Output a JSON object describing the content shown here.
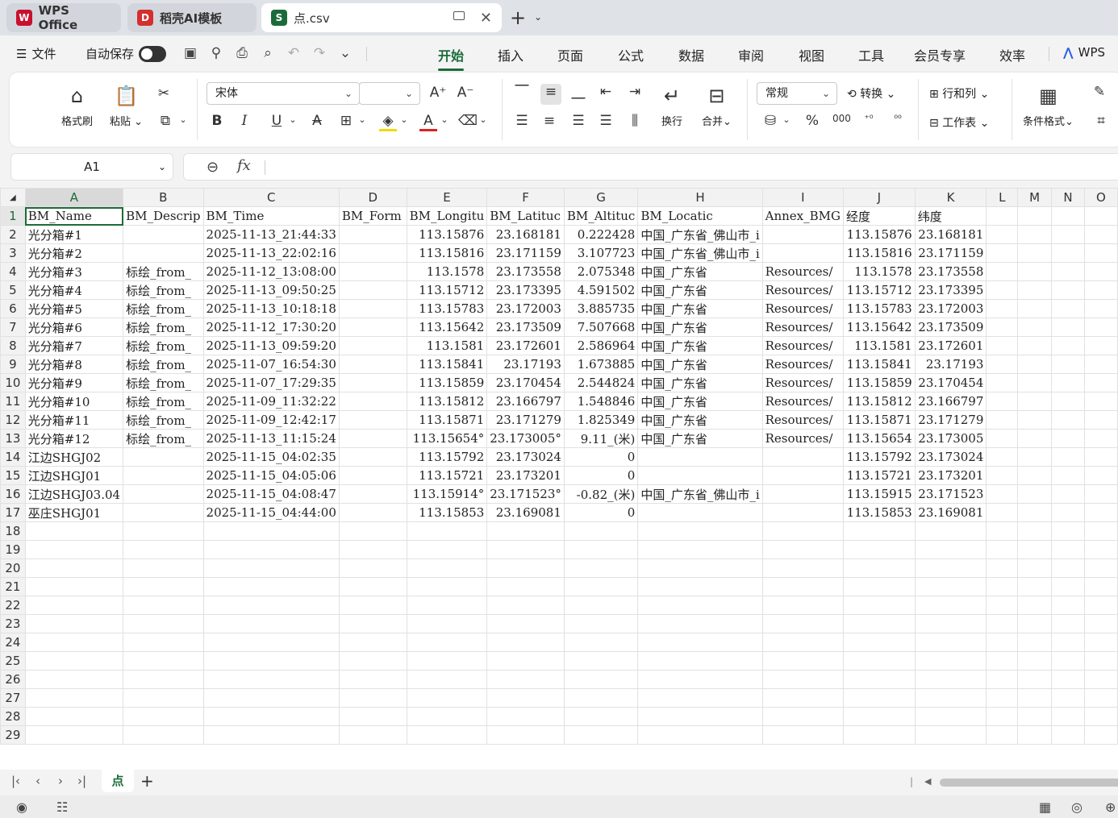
{
  "tabs": [
    {
      "label": "WPS Office",
      "logo": "W",
      "logo_color": "#c8102e"
    },
    {
      "label": "稻壳AI模板",
      "logo": "D",
      "logo_color": "#d32f2f"
    },
    {
      "label": "点.csv",
      "logo": "S",
      "logo_color": "#1b6b3a"
    }
  ],
  "menubar": {
    "file": "文件",
    "autosave": "自动保存",
    "tabs": [
      "开始",
      "插入",
      "页面",
      "公式",
      "数据",
      "审阅",
      "视图",
      "工具",
      "会员专享",
      "效率"
    ],
    "brand": "WPS"
  },
  "ribbon": {
    "format_painter": "格式刷",
    "paste": "粘贴",
    "font_name": "宋体",
    "font_size": "",
    "wrap": "换行",
    "merge": "合并",
    "number_format": "常规",
    "convert": "转换",
    "rows_cols": "行和列",
    "worksheet": "工作表",
    "cond_format": "条件格式"
  },
  "namebox": "A1",
  "columns": [
    "A",
    "B",
    "C",
    "D",
    "E",
    "F",
    "G",
    "H",
    "I",
    "J",
    "K",
    "L",
    "M",
    "N",
    "O"
  ],
  "rows": [
    [
      "BM_Name",
      "BM_Descrip",
      "BM_Time",
      "BM_Form",
      "BM_Longitu",
      "BM_Latituc",
      "BM_Altituc",
      "BM_Locatic",
      "Annex_BMG",
      "经度",
      "纬度"
    ],
    [
      "光分箱#1",
      "",
      "2025-11-13_21:44:33",
      "",
      "113.15876",
      "23.168181",
      "0.222428",
      "中国_广东省_佛山市_i",
      "",
      "113.15876",
      "23.168181"
    ],
    [
      "光分箱#2",
      "",
      "2025-11-13_22:02:16",
      "",
      "113.15816",
      "23.171159",
      "3.107723",
      "中国_广东省_佛山市_i",
      "",
      "113.15816",
      "23.171159"
    ],
    [
      "光分箱#3",
      "标绘_from_",
      "2025-11-12_13:08:00",
      "",
      "113.1578",
      "23.173558",
      "2.075348",
      "中国_广东省",
      "Resources/",
      "113.1578",
      "23.173558"
    ],
    [
      "光分箱#4",
      "标绘_from_",
      "2025-11-13_09:50:25",
      "",
      "113.15712",
      "23.173395",
      "4.591502",
      "中国_广东省",
      "Resources/",
      "113.15712",
      "23.173395"
    ],
    [
      "光分箱#5",
      "标绘_from_",
      "2025-11-13_10:18:18",
      "",
      "113.15783",
      "23.172003",
      "3.885735",
      "中国_广东省",
      "Resources/",
      "113.15783",
      "23.172003"
    ],
    [
      "光分箱#6",
      "标绘_from_",
      "2025-11-12_17:30:20",
      "",
      "113.15642",
      "23.173509",
      "7.507668",
      "中国_广东省",
      "Resources/",
      "113.15642",
      "23.173509"
    ],
    [
      "光分箱#7",
      "标绘_from_",
      "2025-11-13_09:59:20",
      "",
      "113.1581",
      "23.172601",
      "2.586964",
      "中国_广东省",
      "Resources/",
      "113.1581",
      "23.172601"
    ],
    [
      "光分箱#8",
      "标绘_from_",
      "2025-11-07_16:54:30",
      "",
      "113.15841",
      "23.17193",
      "1.673885",
      "中国_广东省",
      "Resources/",
      "113.15841",
      "23.17193"
    ],
    [
      "光分箱#9",
      "标绘_from_",
      "2025-11-07_17:29:35",
      "",
      "113.15859",
      "23.170454",
      "2.544824",
      "中国_广东省",
      "Resources/",
      "113.15859",
      "23.170454"
    ],
    [
      "光分箱#10",
      "标绘_from_",
      "2025-11-09_11:32:22",
      "",
      "113.15812",
      "23.166797",
      "1.548846",
      "中国_广东省",
      "Resources/",
      "113.15812",
      "23.166797"
    ],
    [
      "光分箱#11",
      "标绘_from_",
      "2025-11-09_12:42:17",
      "",
      "113.15871",
      "23.171279",
      "1.825349",
      "中国_广东省",
      "Resources/",
      "113.15871",
      "23.171279"
    ],
    [
      "光分箱#12",
      "标绘_from_",
      "2025-11-13_11:15:24",
      "",
      "113.15654°",
      "23.173005°",
      "9.11_(米)",
      "中国_广东省",
      "Resources/",
      "113.15654",
      "23.173005"
    ],
    [
      "江边SHGJ02",
      "",
      "2025-11-15_04:02:35",
      "",
      "113.15792",
      "23.173024",
      "0",
      "",
      "",
      "113.15792",
      "23.173024"
    ],
    [
      "江边SHGJ01",
      "",
      "2025-11-15_04:05:06",
      "",
      "113.15721",
      "23.173201",
      "0",
      "",
      "",
      "113.15721",
      "23.173201"
    ],
    [
      "江边SHGJ03.04",
      "",
      "2025-11-15_04:08:47",
      "",
      "113.15914°",
      "23.171523°",
      "-0.82_(米)",
      "中国_广东省_佛山市_i",
      "",
      "113.15915",
      "23.171523"
    ],
    [
      "巫庄SHGJ01",
      "",
      "2025-11-15_04:44:00",
      "",
      "113.15853",
      "23.169081",
      "0",
      "",
      "",
      "113.15853",
      "23.169081"
    ]
  ],
  "total_rows": 29,
  "sheet_tab": "点"
}
